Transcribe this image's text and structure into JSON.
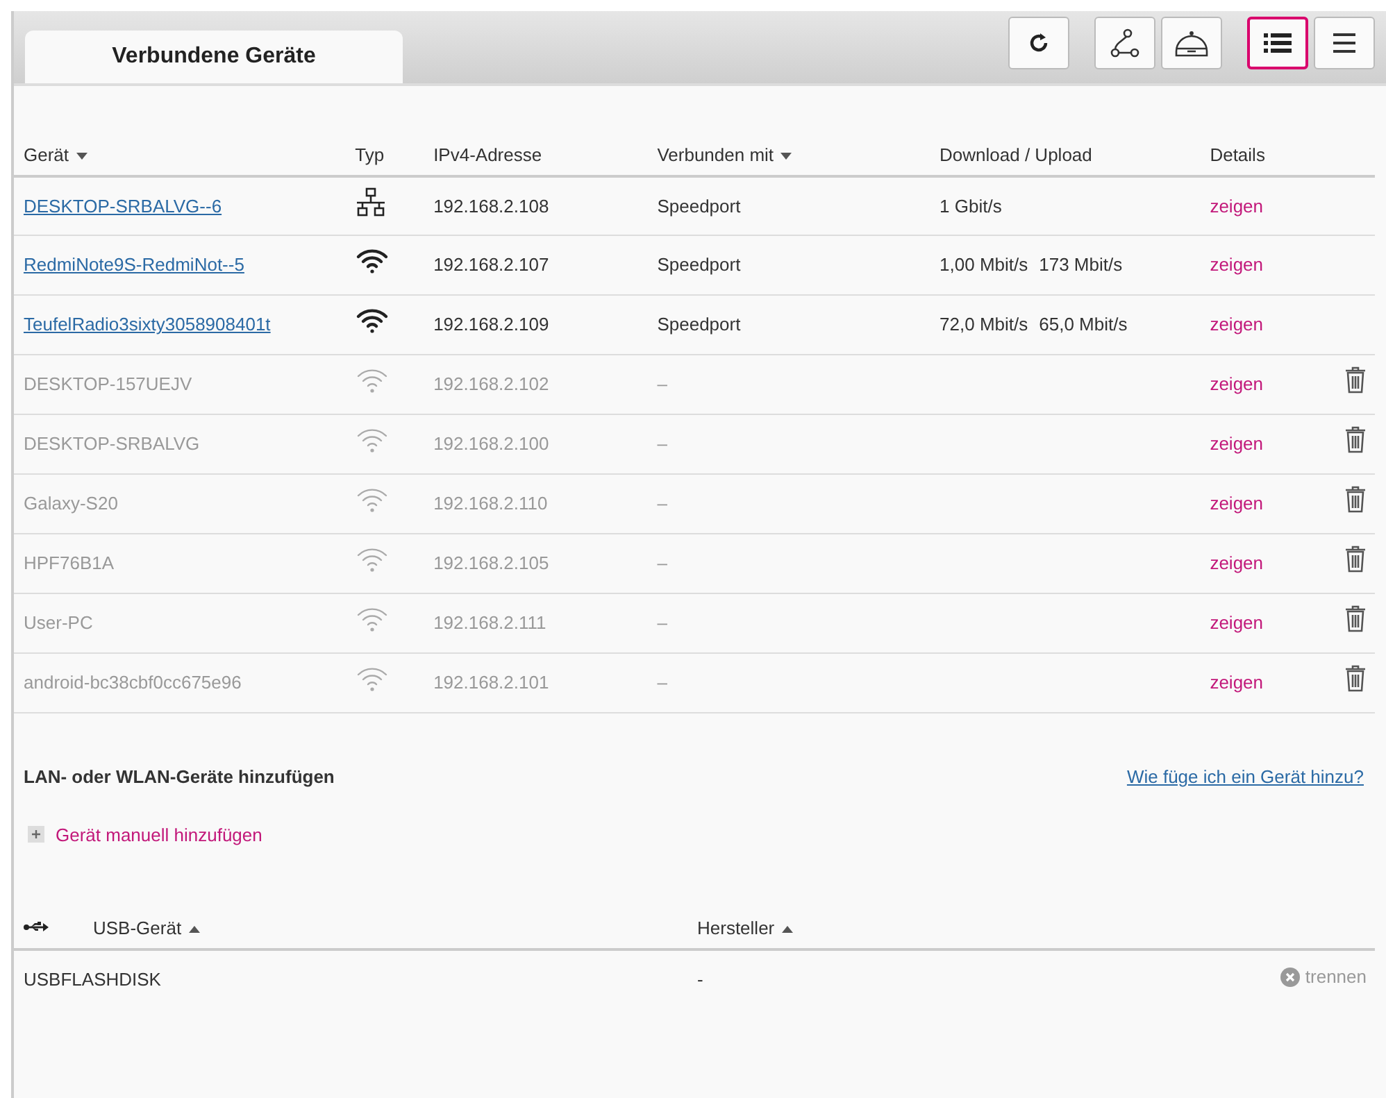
{
  "tab": {
    "label": "Verbundene Geräte",
    "selected": true
  },
  "toolbar": [
    {
      "kind": "refresh",
      "selected": false
    },
    {
      "kind": "topology",
      "selected": false
    },
    {
      "kind": "router",
      "selected": false
    },
    {
      "kind": "list",
      "selected": true
    },
    {
      "kind": "menu",
      "selected": false
    }
  ],
  "devices_table": {
    "columns": [
      {
        "label": "Gerät",
        "ascending": false
      },
      {
        "label": "Typ"
      },
      {
        "label": "IPv4-Adresse"
      },
      {
        "label": "Verbunden mit",
        "ascending": false
      },
      {
        "label": "Download / Upload"
      },
      {
        "label": "Details"
      }
    ],
    "rows": [
      {
        "name": "DESKTOP-SRBALVG--6",
        "kind": "lan",
        "online": true,
        "ip": "192.168.2.108",
        "connected_to": "Speedport",
        "download": "1 Gbit/s",
        "details": "zeigen"
      },
      {
        "name": "RedmiNote9S-RedmiNot--5",
        "kind": "wlan",
        "online": true,
        "ip": "192.168.2.107",
        "connected_to": "Speedport",
        "download": "1,00 Mbit/s",
        "upload": "173 Mbit/s",
        "details": "zeigen"
      },
      {
        "name": "TeufelRadio3sixty3058908401t",
        "kind": "wlan",
        "online": true,
        "ip": "192.168.2.109",
        "connected_to": "Speedport",
        "download": "72,0 Mbit/s",
        "upload": "65,0 Mbit/s",
        "details": "zeigen"
      },
      {
        "name": "DESKTOP-157UEJV",
        "kind": "wlan",
        "online": false,
        "ip": "192.168.2.102",
        "connected_to": "–",
        "details": "zeigen"
      },
      {
        "name": "DESKTOP-SRBALVG",
        "kind": "wlan",
        "online": false,
        "ip": "192.168.2.100",
        "connected_to": "–",
        "details": "zeigen"
      },
      {
        "name": "Galaxy-S20",
        "kind": "wlan",
        "online": false,
        "ip": "192.168.2.110",
        "connected_to": "–",
        "details": "zeigen"
      },
      {
        "name": "HPF76B1A",
        "kind": "wlan",
        "online": false,
        "ip": "192.168.2.105",
        "connected_to": "–",
        "details": "zeigen"
      },
      {
        "name": "User-PC",
        "kind": "wlan",
        "online": false,
        "ip": "192.168.2.111",
        "connected_to": "–",
        "details": "zeigen"
      },
      {
        "name": "android-bc38cbf0cc675e96",
        "kind": "wlan",
        "online": false,
        "ip": "192.168.2.101",
        "connected_to": "–",
        "details": "zeigen"
      }
    ]
  },
  "add_section": {
    "title": "LAN- oder WLAN-Geräte hinzufügen",
    "help_link": "Wie füge ich ein Gerät hinzu?",
    "manual_add": "Gerät manuell hinzufügen"
  },
  "usb_table": {
    "columns": [
      {
        "label": "USB-Gerät",
        "ascending": true
      },
      {
        "label": "Hersteller",
        "ascending": true
      }
    ],
    "rows": [
      {
        "name": "USBFLASHDISK",
        "manufacturer": "-",
        "action": "trennen"
      }
    ]
  }
}
